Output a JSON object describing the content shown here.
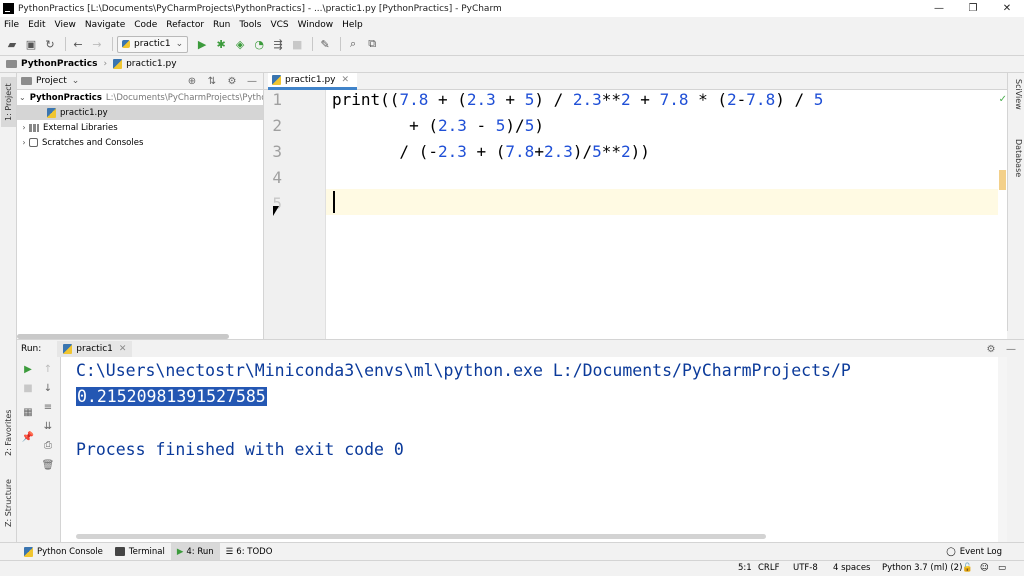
{
  "window": {
    "title": "PythonPractics [L:\\Documents\\PyCharmProjects\\PythonPractics] - ...\\practic1.py [PythonPractics] - PyCharm",
    "controls": [
      "—",
      "❐",
      "✕"
    ]
  },
  "menu": [
    "File",
    "Edit",
    "View",
    "Navigate",
    "Code",
    "Refactor",
    "Run",
    "Tools",
    "VCS",
    "Window",
    "Help"
  ],
  "toolbar": {
    "run_config": "practic1"
  },
  "navbar": {
    "project": "PythonPractics",
    "file": "practic1.py"
  },
  "left_strip": {
    "project_tab": "1: Project",
    "favorites_tab": "2: Favorites",
    "structure_tab": "Z: Structure"
  },
  "right_strip": {
    "sciview_tab": "SciView",
    "database_tab": "Database"
  },
  "project_panel": {
    "title": "Project",
    "root": {
      "name": "PythonPractics",
      "path": "L:\\Documents\\PyCharmProjects\\Pytho"
    },
    "file": "practic1.py",
    "external_libraries": "External Libraries",
    "scratches": "Scratches and Consoles"
  },
  "editor": {
    "tab": "practic1.py",
    "line_numbers": [
      "1",
      "2",
      "3",
      "4",
      "5"
    ],
    "lines": [
      "print((7.8 + (2.3 + 5) / 2.3**2 + 7.8 * (2-7.8) / 5",
      "        + (2.3 - 5)/5)",
      "       / (-2.3 + (7.8+2.3)/5**2))",
      "",
      ""
    ]
  },
  "run_panel": {
    "label": "Run:",
    "tab": "practic1",
    "output": {
      "command": "C:\\Users\\nectostr\\Miniconda3\\envs\\ml\\python.exe L:/Documents/PyCharmProjects/P",
      "result": "0.21520981391527585",
      "exit": "Process finished with exit code 0"
    }
  },
  "bottom_tabs": {
    "python_console": "Python Console",
    "terminal": "Terminal",
    "run": "4: Run",
    "todo": "6: TODO",
    "event_log": "Event Log"
  },
  "status_bar": {
    "position": "5:1",
    "line_sep": "CRLF",
    "encoding": "UTF-8",
    "indent": "4 spaces",
    "interpreter": "Python 3.7 (ml) (2)"
  }
}
